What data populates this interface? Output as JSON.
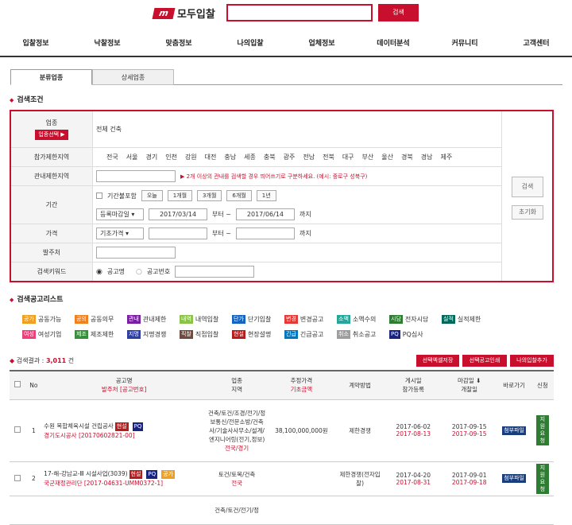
{
  "brand": {
    "logo_mark": "m",
    "name": "모두입찰",
    "search_btn": "검색"
  },
  "nav": [
    "입찰정보",
    "낙찰정보",
    "맞춤정보",
    "나의입찰",
    "업체정보",
    "데이터분석",
    "커뮤니티",
    "고객센터"
  ],
  "tabs": [
    "분류업종",
    "상세업종"
  ],
  "cond": {
    "title": "검색조건",
    "industry_label": "업종",
    "industry_btn": "업종선택 ▶",
    "industry_values": "전체  건축",
    "region_label": "참가제한지역",
    "regions": [
      "전국",
      "서울",
      "경기",
      "인천",
      "강원",
      "대전",
      "충남",
      "세종",
      "충북",
      "광주",
      "전남",
      "전북",
      "대구",
      "부산",
      "울산",
      "경북",
      "경남",
      "제주"
    ],
    "area_label": "관내제한지역",
    "area_note": "▶ 2개 이상의 관내를 검색할 경우 띄어쓰기로 구분하세요. (예시: 중로구 성북구)",
    "period_label": "기간",
    "period_check": "기간불포함",
    "period_btns": [
      "오늘",
      "1개월",
      "3개월",
      "6개월",
      "1년"
    ],
    "date_type": "등록마감일 ▾",
    "date_from": "2017/03/14",
    "date_sep": "부터 ~",
    "date_to": "2017/06/14",
    "date_end": "까지",
    "price_label": "가격",
    "price_type": "기초가격 ▾",
    "price_sep": "부터 ~",
    "price_end": "까지",
    "org_label": "발주처",
    "kw_label": "검색키워드",
    "kw_opt1": "공고명",
    "kw_opt2": "공고번호",
    "search_btn": "검색",
    "reset_btn": "초기화"
  },
  "legend": {
    "title": "검색공고리스트",
    "items": [
      {
        "t": "공가",
        "c": "#f0a020",
        "l": "공동가능"
      },
      {
        "t": "공의",
        "c": "#f08020",
        "l": "공동의무"
      },
      {
        "t": "관내",
        "c": "#7b1fa2",
        "l": "관내제한"
      },
      {
        "t": "내역",
        "c": "#8bc34a",
        "l": "내역입찰"
      },
      {
        "t": "단가",
        "c": "#1565c0",
        "l": "단기입찰"
      },
      {
        "t": "변경",
        "c": "#e53935",
        "l": "변경공고"
      },
      {
        "t": "소액",
        "c": "#26a69a",
        "l": "소액수의"
      },
      {
        "t": "시담",
        "c": "#2e7d32",
        "l": "전자시담"
      },
      {
        "t": "실적",
        "c": "#00695c",
        "l": "실적제한"
      },
      {
        "t": "여성",
        "c": "#ec407a",
        "l": "여성기업"
      },
      {
        "t": "제조",
        "c": "#388e3c",
        "l": "제조제한"
      },
      {
        "t": "지명",
        "c": "#303f9f",
        "l": "지명경쟁"
      },
      {
        "t": "직찰",
        "c": "#6d4c41",
        "l": "직접입찰"
      },
      {
        "t": "현설",
        "c": "#b71c1c",
        "l": "현장설명"
      },
      {
        "t": "긴급",
        "c": "#0277bd",
        "l": "긴급공고"
      },
      {
        "t": "취소",
        "c": "#9e9e9e",
        "l": "취소공고"
      },
      {
        "t": "PQ",
        "c": "#1a237e",
        "l": "PQ심사"
      }
    ]
  },
  "results": {
    "count_label": "검색결과 :",
    "count": "3,011",
    "count_unit": "건",
    "buttons": [
      "선택엑셀저장",
      "선택공고인쇄",
      "나의입찰추가"
    ],
    "headers": {
      "no": "No",
      "name": "공고명",
      "org": "발주처 [공고번호]",
      "ind": "업종",
      "region": "지역",
      "price": "추정가격",
      "base": "기초금액",
      "method": "계약방법",
      "posted": "게시일",
      "reg": "참가등록",
      "deadline": "마감일 ⬇",
      "open": "개찰일",
      "view": "바로가기",
      "apply": "신청"
    },
    "rows": [
      {
        "no": "1",
        "name": "수원 복합체육시설 건립공사",
        "tags": [
          {
            "t": "현설",
            "c": "#b71c1c"
          },
          {
            "t": "PQ",
            "c": "#1a237e"
          }
        ],
        "org": "경기도시공사 [20170602821-00]",
        "ind": "건축/토건/조경/전기/정보통신/전문소방/건축사/기술사사무소/설계/엔지니어링(전기,정보)",
        "region": "전국/경기",
        "price": "38,100,000,000원",
        "method": "제한경쟁",
        "posted": "2017-06-02",
        "reg": "2017-08-13",
        "deadline": "2017-09-15",
        "open": "2017-09-15",
        "view": "첨부파일",
        "apply": "지원요청"
      },
      {
        "no": "2",
        "name": "17-해-강남교-Ⅲ 시설사업(3039)",
        "tags": [
          {
            "t": "현설",
            "c": "#b71c1c"
          },
          {
            "t": "PQ",
            "c": "#1a237e"
          },
          {
            "t": "공가",
            "c": "#f0a020"
          }
        ],
        "org": "국군재정관리단 [2017-04631-UMM0372-1]",
        "ind": "토건/토목/건축",
        "region": "전국",
        "price": "",
        "method": "제한경쟁(전자입찰)",
        "posted": "2017-04-20",
        "reg": "2017-08-31",
        "deadline": "2017-09-01",
        "open": "2017-09-18",
        "view": "첨부파일",
        "apply": "지원요청"
      },
      {
        "no": "",
        "name": "",
        "tags": [],
        "org": "",
        "ind": "건축/토건/전기/정",
        "region": "",
        "price": "",
        "method": "",
        "posted": "",
        "reg": "",
        "deadline": "",
        "open": "",
        "view": "",
        "apply": ""
      }
    ]
  }
}
